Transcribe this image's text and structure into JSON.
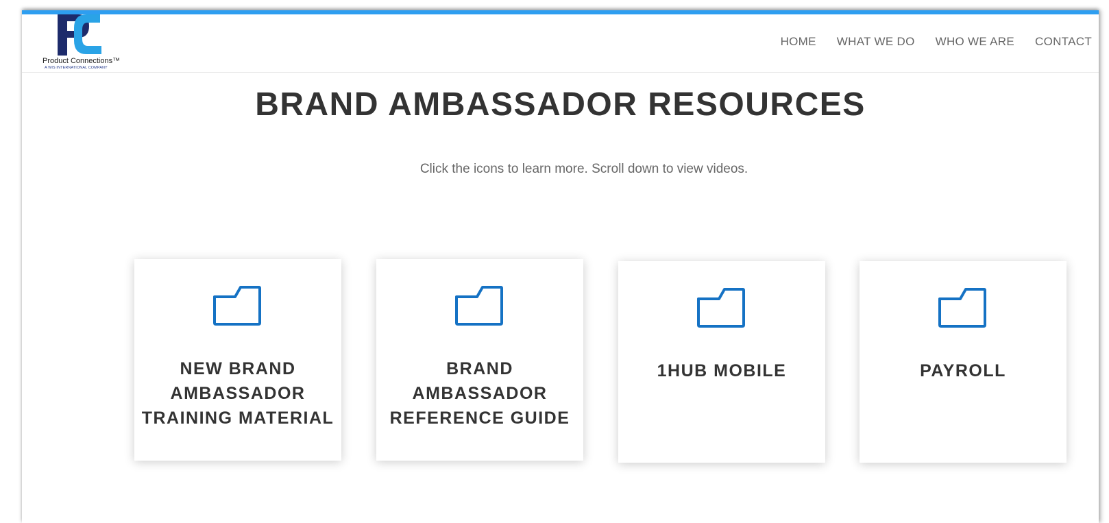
{
  "brand": {
    "name": "Product Connections",
    "trademark": "™",
    "tagline": "A WIS INTERNATIONAL COMPANY"
  },
  "nav": {
    "items": [
      {
        "label": "HOME"
      },
      {
        "label": "WHAT WE DO"
      },
      {
        "label": "WHO WE ARE"
      },
      {
        "label": "CONTACT"
      }
    ]
  },
  "main": {
    "title": "BRAND AMBASSADOR RESOURCES",
    "subtitle": "Click the icons to learn more. Scroll down to view videos.",
    "cards": [
      {
        "label": "NEW BRAND AMBASSADOR TRAINING MATERIAL",
        "icon": "folder-icon"
      },
      {
        "label": "BRAND AMBASSADOR REFERENCE GUIDE",
        "icon": "folder-icon"
      },
      {
        "label": "1HUB MOBILE",
        "icon": "folder-icon"
      },
      {
        "label": "PAYROLL",
        "icon": "folder-icon"
      }
    ]
  },
  "colors": {
    "accent_bar": "#2e9ef0",
    "icon_blue": "#1572c4",
    "logo_navy": "#1d2b6b",
    "logo_light_blue": "#2aa3e6",
    "heading": "#333333",
    "body_text": "#666666"
  }
}
